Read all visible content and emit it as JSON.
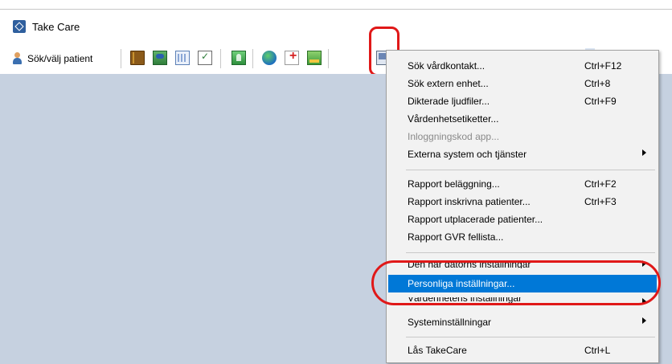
{
  "app": {
    "title": "Take Care"
  },
  "toolbar": {
    "patient_button": "Sök/välj patient",
    "icons": [
      "book-icon",
      "people-icon",
      "calendar-icon",
      "checklist-icon",
      "screen-person-icon",
      "globe-icon",
      "add-record-icon",
      "card-icon",
      "computer-icon"
    ]
  },
  "menu": {
    "items": [
      {
        "label": "Sök vårdkontakt...",
        "shortcut": "Ctrl+F12"
      },
      {
        "label": "Sök extern enhet...",
        "shortcut": "Ctrl+8"
      },
      {
        "label": "Dikterade ljudfiler...",
        "shortcut": "Ctrl+F9"
      },
      {
        "label": "Vårdenhetsetiketter...",
        "shortcut": ""
      },
      {
        "label": "Inloggningskod app...",
        "shortcut": "",
        "disabled": true
      },
      {
        "label": "Externa system och tjänster",
        "shortcut": "",
        "submenu": true
      },
      {
        "label": "Rapport beläggning...",
        "shortcut": "Ctrl+F2"
      },
      {
        "label": "Rapport inskrivna patienter...",
        "shortcut": "Ctrl+F3"
      },
      {
        "label": "Rapport utplacerade patienter...",
        "shortcut": ""
      },
      {
        "label": "Rapport GVR fellista...",
        "shortcut": ""
      },
      {
        "label": "Den här datorns inställningar",
        "shortcut": "",
        "submenu": true
      },
      {
        "label": "Personliga inställningar...",
        "shortcut": "",
        "selected": true
      },
      {
        "label": "Vårdenhetens inställningar",
        "shortcut": "",
        "submenu": true
      },
      {
        "label": "Systeminställningar",
        "shortcut": "",
        "submenu": true
      },
      {
        "label": "Lås TakeCare",
        "shortcut": "Ctrl+L"
      }
    ]
  },
  "colors": {
    "accent": "#0078d7",
    "highlight_ring": "#e01818",
    "workspace": "#c6d1e0"
  }
}
